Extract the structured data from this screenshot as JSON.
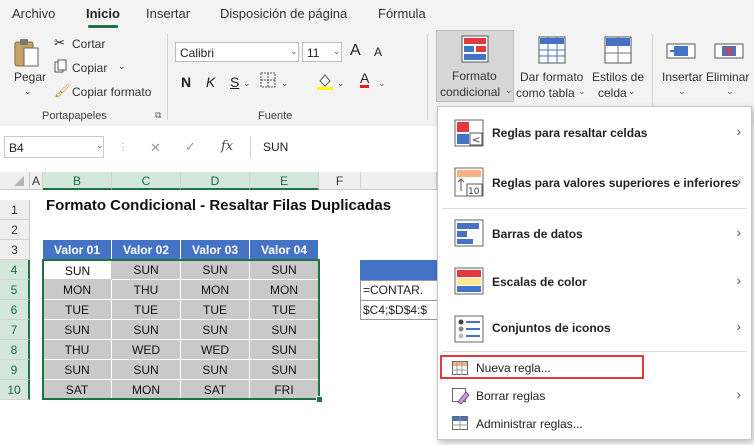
{
  "menubar": {
    "tabs": [
      "Archivo",
      "Inicio",
      "Insertar",
      "Disposición de página",
      "Fórmula"
    ]
  },
  "ribbon": {
    "clipboard": {
      "paste": "Pegar",
      "cut": "Cortar",
      "copy": "Copiar",
      "format_painter": "Copiar formato",
      "group": "Portapapeles"
    },
    "font": {
      "name": "Calibri",
      "size": "11",
      "bold": "N",
      "italic": "K",
      "underline": "S",
      "grow": "A",
      "shrink": "A",
      "font_color": "A",
      "group": "Fuente"
    },
    "styles": {
      "cond_format_line1": "Formato",
      "cond_format_line2": "condicional",
      "table_format_line1": "Dar formato",
      "table_format_line2": "como tabla",
      "cell_styles_line1": "Estilos de",
      "cell_styles_line2": "celda"
    },
    "cells": {
      "insert": "Insertar",
      "delete": "Eliminar"
    }
  },
  "formula_bar": {
    "name_box": "B4",
    "fx": "fx",
    "content": "SUN"
  },
  "grid": {
    "columns": [
      "A",
      "B",
      "C",
      "D",
      "E",
      "F"
    ],
    "rows": [
      "1",
      "2",
      "3",
      "4",
      "5",
      "6",
      "7",
      "8",
      "9",
      "10"
    ],
    "title": "Formato Condicional - Resaltar Filas Duplicadas",
    "headers": [
      "Valor 01",
      "Valor 02",
      "Valor 03",
      "Valor 04"
    ],
    "data": [
      [
        "SUN",
        "SUN",
        "SUN",
        "SUN"
      ],
      [
        "MON",
        "THU",
        "MON",
        "MON"
      ],
      [
        "TUE",
        "TUE",
        "TUE",
        "TUE"
      ],
      [
        "SUN",
        "SUN",
        "SUN",
        "SUN"
      ],
      [
        "THU",
        "WED",
        "WED",
        "SUN"
      ],
      [
        "SUN",
        "SUN",
        "SUN",
        "SUN"
      ],
      [
        "SAT",
        "MON",
        "SAT",
        "FRI"
      ]
    ],
    "formula_snippet_1": "=CONTAR.",
    "formula_snippet_2": "$C4;$D$4:$"
  },
  "cond_format_menu": {
    "items": [
      {
        "label": "Reglas para resaltar celdas",
        "has_submenu": true
      },
      {
        "label": "Reglas para valores superiores e inferiores",
        "has_submenu": true
      },
      {
        "label": "Barras de datos",
        "has_submenu": true
      },
      {
        "label": "Escalas de color",
        "has_submenu": true
      },
      {
        "label": "Conjuntos de iconos",
        "has_submenu": true
      },
      {
        "label": "Nueva regla...",
        "has_submenu": false,
        "highlighted": true
      },
      {
        "label": "Borrar reglas",
        "has_submenu": true
      },
      {
        "label": "Administrar reglas...",
        "has_submenu": false
      }
    ]
  },
  "colors": {
    "accent_green": "#217346",
    "table_header_blue": "#4472c4",
    "cell_grey": "#c9c9c9",
    "highlight_red": "#e0393e"
  }
}
